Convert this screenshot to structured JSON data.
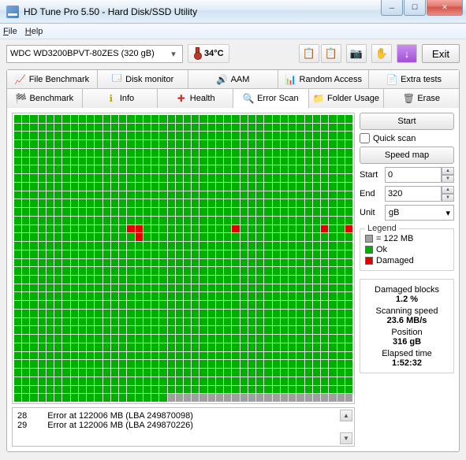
{
  "window": {
    "title": "HD Tune Pro 5.50 - Hard Disk/SSD Utility"
  },
  "menu": {
    "file": "File",
    "help": "Help"
  },
  "drive": {
    "selected": "WDC WD3200BPVT-80ZES (320 gB)"
  },
  "temp": {
    "value": "34°C"
  },
  "exit": {
    "label": "Exit"
  },
  "tabs": {
    "row1": [
      "File Benchmark",
      "Disk monitor",
      "AAM",
      "Random Access",
      "Extra tests"
    ],
    "row2": [
      "Benchmark",
      "Info",
      "Health",
      "Error Scan",
      "Folder Usage",
      "Erase"
    ],
    "active": "Error Scan"
  },
  "scan": {
    "cols": 42,
    "rows": 34,
    "damaged_cells": [
      [
        13,
        14
      ],
      [
        13,
        15
      ],
      [
        14,
        15
      ],
      [
        13,
        27
      ],
      [
        13,
        38
      ],
      [
        13,
        41
      ]
    ],
    "gray_row_start": 33,
    "gray_col_start": 19
  },
  "errors": [
    {
      "n": "28",
      "msg": "Error at 122006 MB (LBA 249870098)"
    },
    {
      "n": "29",
      "msg": "Error at 122006 MB (LBA 249870226)"
    }
  ],
  "controls": {
    "start_btn": "Start",
    "quick_scan": "Quick scan",
    "speed_map": "Speed map",
    "start_label": "Start",
    "start_val": "0",
    "end_label": "End",
    "end_val": "320",
    "unit_label": "Unit",
    "unit_val": "gB"
  },
  "legend": {
    "title": "Legend",
    "block_size": "= 122 MB",
    "ok": "Ok",
    "damaged": "Damaged"
  },
  "stats": {
    "damaged_label": "Damaged blocks",
    "damaged_val": "1.2 %",
    "speed_label": "Scanning speed",
    "speed_val": "23.6 MB/s",
    "pos_label": "Position",
    "pos_val": "316 gB",
    "elapsed_label": "Elapsed time",
    "elapsed_val": "1:52:32"
  }
}
